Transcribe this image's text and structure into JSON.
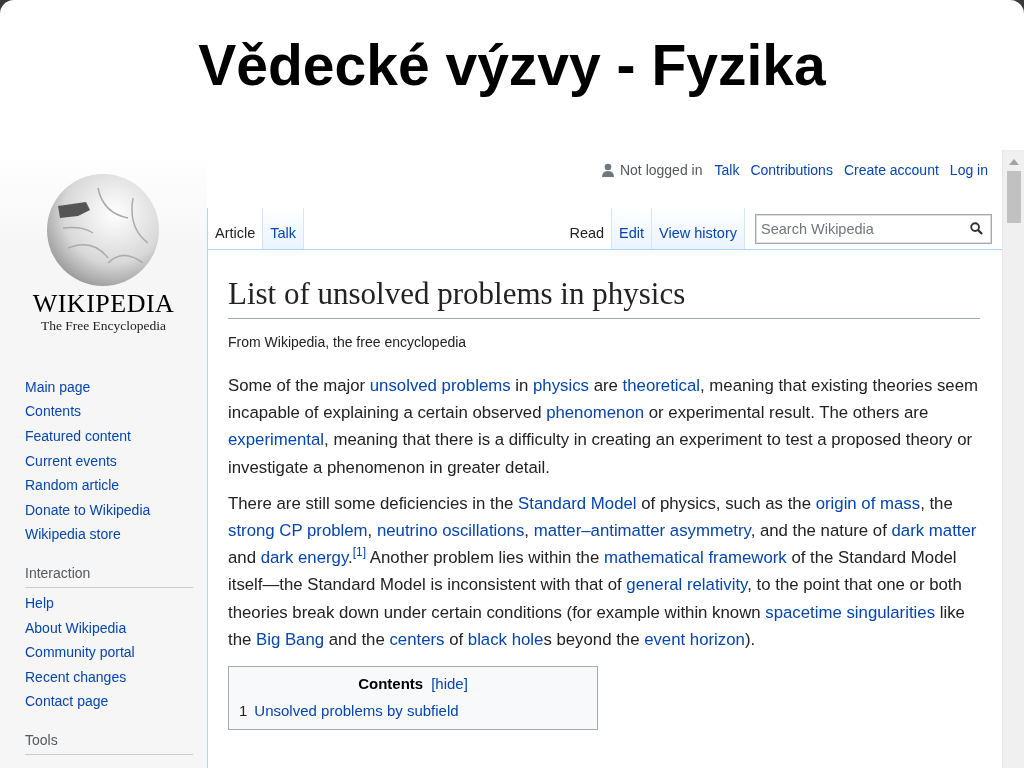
{
  "slide": {
    "title": "Vědecké výzvy - Fyzika"
  },
  "logo": {
    "wordmark": "WIKIPEDIA",
    "tagline": "The Free Encyclopedia"
  },
  "sidebar": {
    "navigation": [
      "Main page",
      "Contents",
      "Featured content",
      "Current events",
      "Random article",
      "Donate to Wikipedia",
      "Wikipedia store"
    ],
    "sections": [
      {
        "heading": "Interaction",
        "items": [
          "Help",
          "About Wikipedia",
          "Community portal",
          "Recent changes",
          "Contact page"
        ]
      },
      {
        "heading": "Tools"
      }
    ]
  },
  "personal_tools": {
    "status": "Not logged in",
    "links": [
      "Talk",
      "Contributions",
      "Create account",
      "Log in"
    ]
  },
  "namespace_tabs": [
    {
      "label": "Article",
      "selected": true
    },
    {
      "label": "Talk",
      "selected": false
    }
  ],
  "view_tabs": [
    {
      "label": "Read",
      "selected": true
    },
    {
      "label": "Edit",
      "selected": false
    },
    {
      "label": "View history",
      "selected": false
    }
  ],
  "search": {
    "placeholder": "Search Wikipedia"
  },
  "article": {
    "title": "List of unsolved problems in physics",
    "tagline": "From Wikipedia, the free encyclopedia",
    "paragraphs": [
      [
        {
          "kind": "text",
          "text": "Some of the major "
        },
        {
          "kind": "link",
          "text": "unsolved problems"
        },
        {
          "kind": "text",
          "text": " in "
        },
        {
          "kind": "link",
          "text": "physics"
        },
        {
          "kind": "text",
          "text": " are "
        },
        {
          "kind": "link",
          "text": "theoretical"
        },
        {
          "kind": "text",
          "text": ", meaning that existing theories seem incapable of explaining a certain observed "
        },
        {
          "kind": "link",
          "text": "phenomenon"
        },
        {
          "kind": "text",
          "text": " or experimental result. The others are "
        },
        {
          "kind": "link",
          "text": "experimental"
        },
        {
          "kind": "text",
          "text": ", meaning that there is a difficulty in creating an experiment to test a proposed theory or investigate a phenomenon in greater detail."
        }
      ],
      [
        {
          "kind": "text",
          "text": "There are still some deficiencies in the "
        },
        {
          "kind": "link",
          "text": "Standard Model"
        },
        {
          "kind": "text",
          "text": " of physics, such as the "
        },
        {
          "kind": "link",
          "text": "origin of mass"
        },
        {
          "kind": "text",
          "text": ", the "
        },
        {
          "kind": "link",
          "text": "strong CP problem"
        },
        {
          "kind": "text",
          "text": ", "
        },
        {
          "kind": "link",
          "text": "neutrino oscillations"
        },
        {
          "kind": "text",
          "text": ", "
        },
        {
          "kind": "link",
          "text": "matter–antimatter asymmetry"
        },
        {
          "kind": "text",
          "text": ", and the nature of "
        },
        {
          "kind": "link",
          "text": "dark matter"
        },
        {
          "kind": "text",
          "text": " and "
        },
        {
          "kind": "link",
          "text": "dark energy"
        },
        {
          "kind": "text",
          "text": "."
        },
        {
          "kind": "ref",
          "text": "[1]"
        },
        {
          "kind": "text",
          "text": " Another problem lies within the "
        },
        {
          "kind": "link",
          "text": "mathematical framework"
        },
        {
          "kind": "text",
          "text": " of the Standard Model itself—the Standard Model is inconsistent with that of "
        },
        {
          "kind": "link",
          "text": "general relativity"
        },
        {
          "kind": "text",
          "text": ", to the point that one or both theories break down under certain conditions (for example within known "
        },
        {
          "kind": "link",
          "text": "spacetime singularities"
        },
        {
          "kind": "text",
          "text": " like the "
        },
        {
          "kind": "link",
          "text": "Big Bang"
        },
        {
          "kind": "text",
          "text": " and the "
        },
        {
          "kind": "link",
          "text": "centers"
        },
        {
          "kind": "text",
          "text": " of "
        },
        {
          "kind": "link",
          "text": "black hole"
        },
        {
          "kind": "text",
          "text": "s beyond the "
        },
        {
          "kind": "link",
          "text": "event horizon"
        },
        {
          "kind": "text",
          "text": ")."
        }
      ]
    ],
    "toc": {
      "title": "Contents",
      "toggle": "[hide]",
      "items": [
        {
          "number": "1",
          "text": "Unsolved problems by subfield"
        }
      ]
    }
  }
}
